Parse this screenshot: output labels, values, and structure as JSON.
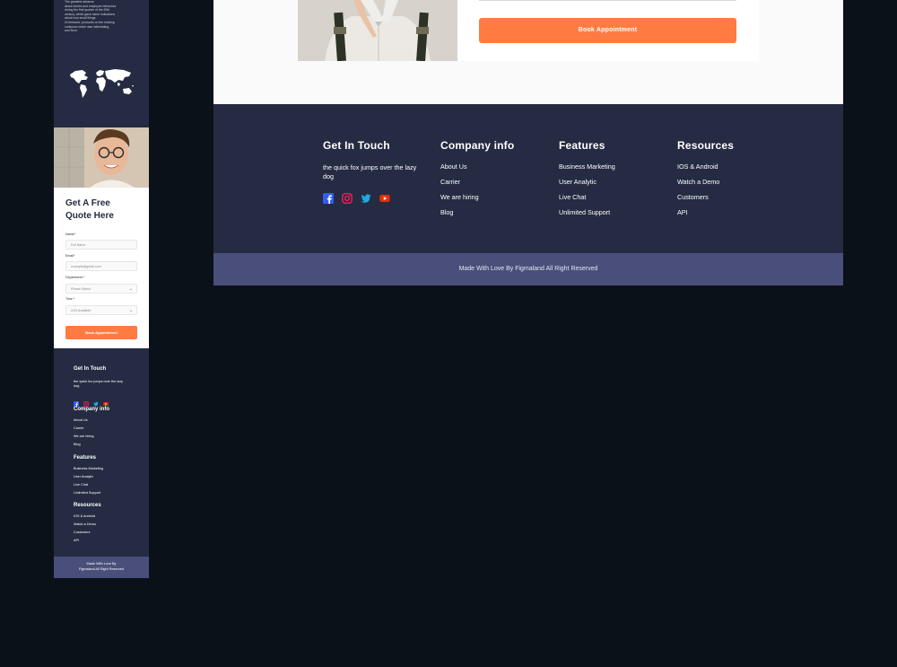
{
  "mobile": {
    "hero_text": [
      "The greatest advance",
      "about stories and employee behaviour",
      "during the first quarter of the 20th",
      "century, which gave name indications",
      "about how small things",
      "Ut behavior, protocols on the existing",
      "confusion which was intimidating,",
      "and Born."
    ],
    "form": {
      "title": "Get A Free Quote Here",
      "name_label": "Name*",
      "name_placeholder": "Full Name",
      "email_label": "Email*",
      "email_placeholder": "example@gmail.com",
      "department_label": "Department *",
      "department_value": "Please Select",
      "time_label": "Time *",
      "time_value": "4:00 Available",
      "button": "Book Appointment"
    },
    "footer": {
      "get_in_touch": {
        "title": "Get In Touch",
        "text": "the quick fox jumps over the lazy dog"
      },
      "company": {
        "title": "Company info",
        "links": [
          "About Us",
          "Carrier",
          "We are hiring",
          "Blog"
        ]
      },
      "features": {
        "title": "Features",
        "links": [
          "Business Marketing",
          "User Analytic",
          "Live Chat",
          "Unlimited Support"
        ]
      },
      "resources": {
        "title": "Resources",
        "links": [
          "IOS & Android",
          "Watch a Demo",
          "Customers",
          "API"
        ]
      },
      "bottom": [
        "Made With Love By",
        "Figmaland All Right Reserved"
      ]
    }
  },
  "desktop": {
    "button": "Book Appointment",
    "footer": {
      "get_in_touch": {
        "title": "Get In Touch",
        "text": "the quick fox jumps over the lazy dog"
      },
      "company": {
        "title": "Company info",
        "links": [
          "About Us",
          "Carrier",
          "We are hiring",
          "Blog"
        ]
      },
      "features": {
        "title": "Features",
        "links": [
          "Business Marketing",
          "User Analytic",
          "Live Chat",
          "Unlimited Support"
        ]
      },
      "resources": {
        "title": "Resources",
        "links": [
          "IOS & Android",
          "Watch a Demo",
          "Customers",
          "API"
        ]
      },
      "bottom": "Made With Love By Figmaland All Right Reserved"
    }
  },
  "socials": [
    "facebook-icon",
    "instagram-icon",
    "twitter-icon",
    "youtube-icon"
  ],
  "colors": {
    "navy": "#252b42",
    "accent": "#ff7b42",
    "footer_bottom": "#494f7a",
    "background": "#0b1119",
    "facebook": "#335bf5",
    "instagram": "#e51f5a",
    "twitter": "#21a6df",
    "youtube": "#e42f08"
  }
}
